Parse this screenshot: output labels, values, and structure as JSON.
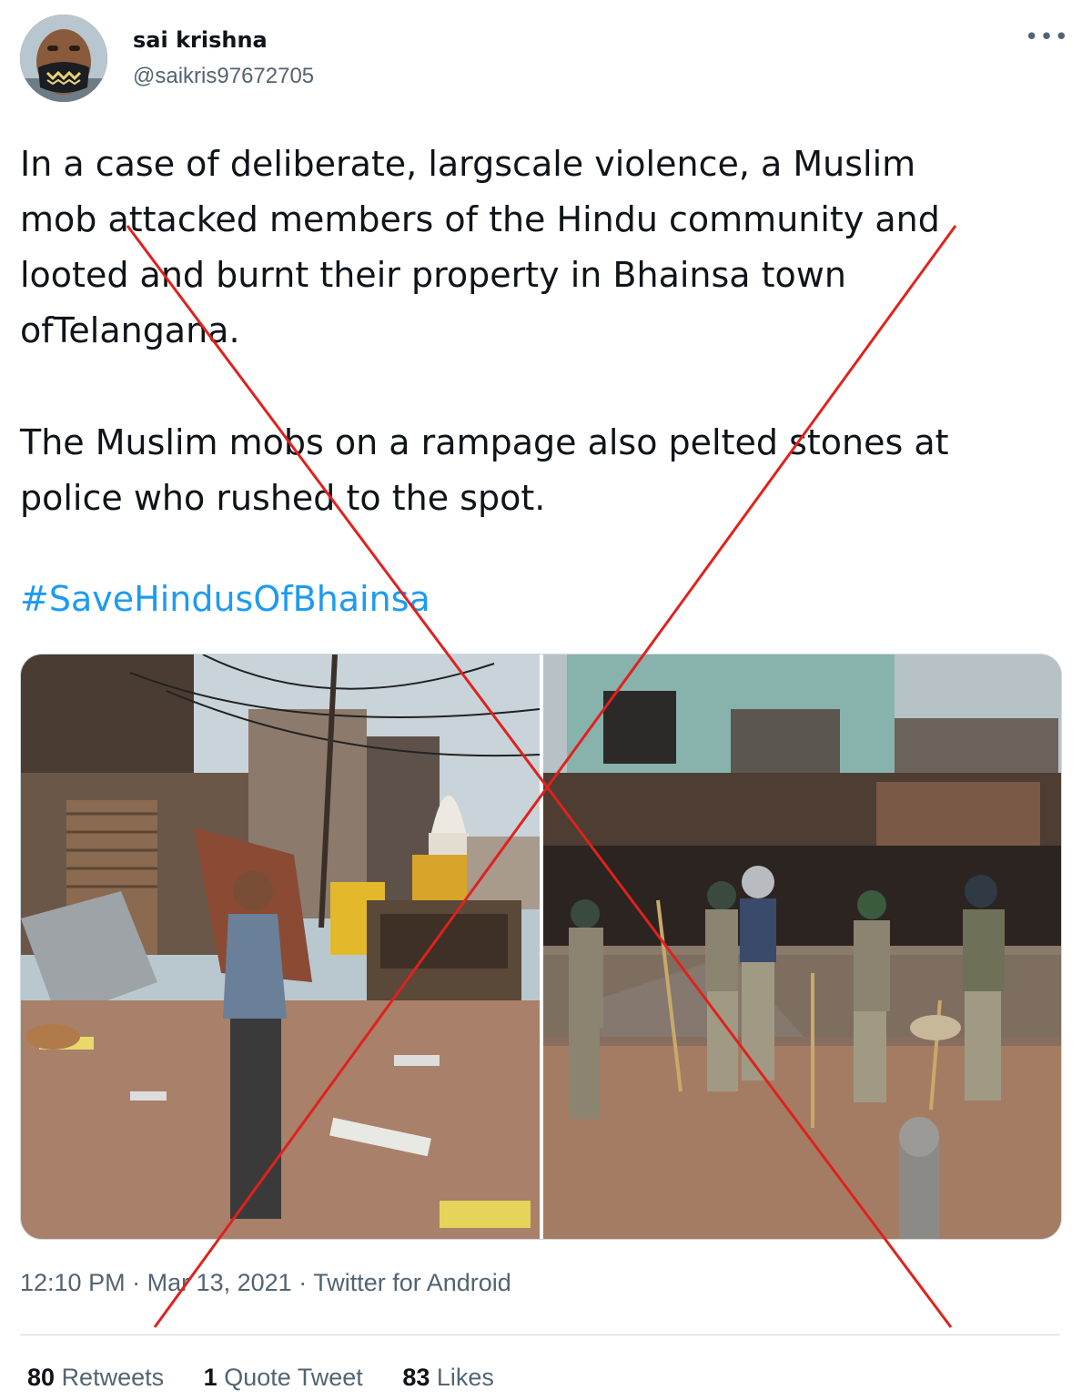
{
  "tweet": {
    "author_name": "sai krishna",
    "author_handle": "@saikris97672705",
    "more_icon": "more-options-icon",
    "paragraph_1_lines": [
      "In a case of deliberate, largscale violence, a Muslim",
      "mob attacked members of the Hindu community and",
      "looted and burnt their property in Bhainsa town",
      "ofTelangana."
    ],
    "paragraph_2_lines": [
      "The Muslim mobs on a rampage also pelted stones at",
      "police who rushed to the spot."
    ],
    "hashtag": "#SaveHindusOfBhainsa",
    "time": "12:10 PM",
    "date": "Mar 13, 2021",
    "separator": " · ",
    "source": "Twitter for Android",
    "stats": {
      "retweets_count": "80",
      "retweets_label": "Retweets",
      "quotes_count": "1",
      "quotes_label": "Quote Tweet",
      "likes_count": "83",
      "likes_label": "Likes"
    }
  },
  "colors": {
    "link": "#1d9bf0",
    "secondary_text": "#536471",
    "primary_text": "#0f1419",
    "cross_overlay": "#e0211d"
  }
}
